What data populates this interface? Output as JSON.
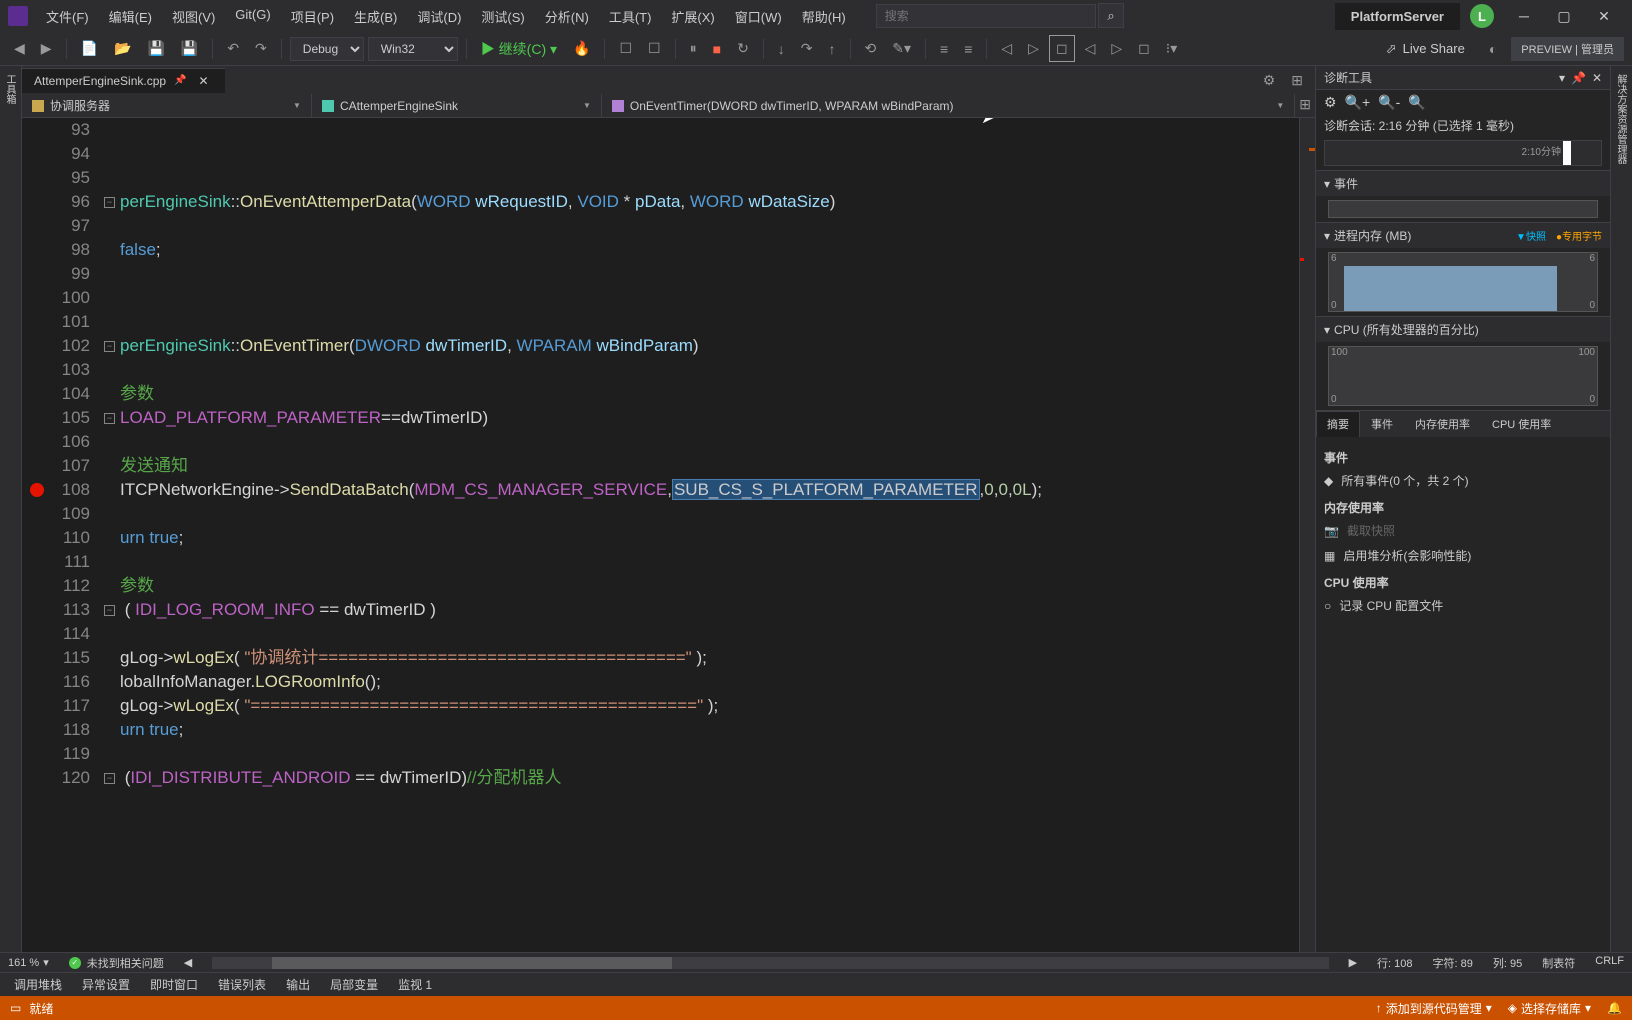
{
  "menu": [
    "文件(F)",
    "编辑(E)",
    "视图(V)",
    "Git(G)",
    "项目(P)",
    "生成(B)",
    "调试(D)",
    "测试(S)",
    "分析(N)",
    "工具(T)",
    "扩展(X)",
    "窗口(W)",
    "帮助(H)"
  ],
  "search_placeholder": "搜索",
  "project_name": "PlatformServer",
  "user_initial": "L",
  "toolbar": {
    "config": "Debug",
    "platform": "Win32",
    "continue": "继续(C)",
    "liveshare": "Live Share",
    "preview": "PREVIEW | 管理员"
  },
  "doc_tab": {
    "filename": "AttemperEngineSink.cpp"
  },
  "breadcrumb": {
    "seg1": "协调服务器",
    "seg2": "CAttemperEngineSink",
    "seg3": "OnEventTimer(DWORD dwTimerID, WPARAM wBindParam)"
  },
  "code_lines": [
    {
      "n": 93,
      "fold": "",
      "html": ""
    },
    {
      "n": 94,
      "fold": "",
      "html": ""
    },
    {
      "n": 95,
      "fold": "",
      "html": ""
    },
    {
      "n": 96,
      "fold": "-",
      "html": "<span class='tk-type'>perEngineSink</span><span class='tk-op'>::</span><span class='tk-func'>OnEventAttemperData</span><span class='tk-op'>(</span><span class='tk-keyword'>WORD</span> <span class='tk-param'>wRequestID</span><span class='tk-op'>,</span> <span class='tk-keyword'>VOID</span> <span class='tk-op'>*</span> <span class='tk-param'>pData</span><span class='tk-op'>,</span> <span class='tk-keyword'>WORD</span> <span class='tk-param'>wDataSize</span><span class='tk-op'>)</span>"
    },
    {
      "n": 97,
      "fold": "",
      "html": ""
    },
    {
      "n": 98,
      "fold": "",
      "html": "<span class='tk-keyword'>false</span><span class='tk-op'>;</span>"
    },
    {
      "n": 99,
      "fold": "",
      "html": ""
    },
    {
      "n": 100,
      "fold": "",
      "html": ""
    },
    {
      "n": 101,
      "fold": "",
      "html": ""
    },
    {
      "n": 102,
      "fold": "-",
      "html": "<span class='tk-type'>perEngineSink</span><span class='tk-op'>::</span><span class='tk-func'>OnEventTimer</span><span class='tk-op'>(</span><span class='tk-keyword'>DWORD</span> <span class='tk-param'>dwTimerID</span><span class='tk-op'>,</span> <span class='tk-keyword'>WPARAM</span> <span class='tk-param'>wBindParam</span><span class='tk-op'>)</span>"
    },
    {
      "n": 103,
      "fold": "",
      "html": ""
    },
    {
      "n": 104,
      "fold": "",
      "html": "<span class='tk-comment'>参数</span>"
    },
    {
      "n": 105,
      "fold": "-",
      "html": "<span class='tk-const'>LOAD_PLATFORM_PARAMETER</span><span class='tk-op'>==</span><span class='tk-default'>dwTimerID</span><span class='tk-op'>)</span>"
    },
    {
      "n": 106,
      "fold": "",
      "html": ""
    },
    {
      "n": 107,
      "fold": "",
      "html": "<span class='tk-comment'>发送通知</span>"
    },
    {
      "n": 108,
      "fold": "",
      "bp": true,
      "html": "<span class='tk-default'>ITCPNetworkEngine</span><span class='tk-op'>-&gt;</span><span class='tk-func'>SendDataBatch</span><span class='tk-op'>(</span><span class='tk-const'>MDM_CS_MANAGER_SERVICE</span><span class='tk-op'>,</span><span class='tk-selected'>SUB_CS_S_PLATFORM_PARAMETER</span><span class='tk-op'>,</span><span class='tk-number'>0</span><span class='tk-op'>,</span><span class='tk-number'>0</span><span class='tk-op'>,</span><span class='tk-number'>0L</span><span class='tk-op'>);</span>"
    },
    {
      "n": 109,
      "fold": "",
      "html": ""
    },
    {
      "n": 110,
      "fold": "",
      "html": "<span class='tk-keyword'>urn</span> <span class='tk-keyword'>true</span><span class='tk-op'>;</span>"
    },
    {
      "n": 111,
      "fold": "",
      "html": ""
    },
    {
      "n": 112,
      "fold": "",
      "html": "<span class='tk-comment'>参数</span>"
    },
    {
      "n": 113,
      "fold": "-",
      "html": " <span class='tk-op'>(</span> <span class='tk-const'>IDI_LOG_ROOM_INFO</span> <span class='tk-op'>==</span> <span class='tk-default'>dwTimerID</span> <span class='tk-op'>)</span>"
    },
    {
      "n": 114,
      "fold": "",
      "html": ""
    },
    {
      "n": 115,
      "fold": "",
      "html": "<span class='tk-default'>gLog</span><span class='tk-op'>-&gt;</span><span class='tk-func'>wLogEx</span><span class='tk-op'>(</span> <span class='tk-string'>\"协调统计=====================================\"</span> <span class='tk-op'>);</span>"
    },
    {
      "n": 116,
      "fold": "",
      "html": "<span class='tk-default'>lobalInfoManager</span><span class='tk-op'>.</span><span class='tk-func'>LOGRoomInfo</span><span class='tk-op'>();</span>"
    },
    {
      "n": 117,
      "fold": "",
      "html": "<span class='tk-default'>gLog</span><span class='tk-op'>-&gt;</span><span class='tk-func'>wLogEx</span><span class='tk-op'>(</span> <span class='tk-string'>\"=============================================\"</span> <span class='tk-op'>);</span>"
    },
    {
      "n": 118,
      "fold": "",
      "html": "<span class='tk-keyword'>urn</span> <span class='tk-keyword'>true</span><span class='tk-op'>;</span>"
    },
    {
      "n": 119,
      "fold": "",
      "html": ""
    },
    {
      "n": 120,
      "fold": "-",
      "html": " <span class='tk-op'>(</span><span class='tk-const'>IDI_DISTRIBUTE_ANDROID</span> <span class='tk-op'>==</span> <span class='tk-default'>dwTimerID</span><span class='tk-op'>)</span><span class='tk-comment'>//分配机器人</span>"
    }
  ],
  "zoom": "161 %",
  "issues_status": "未找到相关问题",
  "cursor": {
    "line_label": "行:",
    "line": "108",
    "char_label": "字符:",
    "char": "89",
    "col_label": "列:",
    "col": "95",
    "tabs": "制表符",
    "crlf": "CRLF"
  },
  "output_tabs": [
    "调用堆栈",
    "异常设置",
    "即时窗口",
    "错误列表",
    "输出",
    "局部变量",
    "监视 1"
  ],
  "statusbar": {
    "ready": "就绪",
    "source_mgmt": "添加到源代码管理",
    "repo": "选择存储库"
  },
  "diag": {
    "title": "诊断工具",
    "session": "诊断会话: 2:16 分钟 (已选择 1 毫秒)",
    "timeline_label": "2:10分钟",
    "events": "事件",
    "mem_header": "进程内存 (MB)",
    "snapshot": "快照",
    "private_bytes": "专用字节",
    "mem_y_max": "6",
    "mem_y_min": "0",
    "cpu_header": "CPU (所有处理器的百分比)",
    "cpu_y_max": "100",
    "cpu_y_min": "0",
    "tabs": [
      "摘要",
      "事件",
      "内存使用率",
      "CPU 使用率"
    ],
    "content": {
      "events_h": "事件",
      "events_all": "所有事件(0 个，共 2 个)",
      "mem_h": "内存使用率",
      "mem_snapshot": "截取快照",
      "mem_heap": "启用堆分析(会影响性能)",
      "cpu_h": "CPU 使用率",
      "cpu_record": "记录 CPU 配置文件"
    }
  }
}
